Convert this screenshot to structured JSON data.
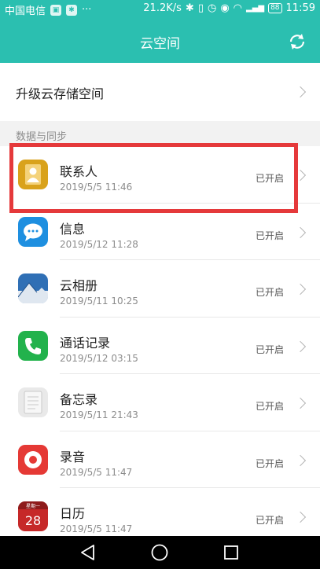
{
  "status_bar": {
    "carrier": "中国电信",
    "speed": "21.2K/s",
    "battery": "88",
    "time": "11:59"
  },
  "header": {
    "title": "云空间"
  },
  "upgrade": {
    "label": "升级云存储空间"
  },
  "section": {
    "title": "数据与同步"
  },
  "items": [
    {
      "name": "联系人",
      "time": "2019/5/5 11:46",
      "status": "已开启",
      "icon": "contacts-icon",
      "color": "#d9a21b"
    },
    {
      "name": "信息",
      "time": "2019/5/12 11:28",
      "status": "已开启",
      "icon": "message-icon",
      "color": "#1e8fe0"
    },
    {
      "name": "云相册",
      "time": "2019/5/11 10:25",
      "status": "已开启",
      "icon": "gallery-icon",
      "color": "#2f6fb5"
    },
    {
      "name": "通话记录",
      "time": "2019/5/12 03:15",
      "status": "已开启",
      "icon": "phone-icon",
      "color": "#22b24c"
    },
    {
      "name": "备忘录",
      "time": "2019/5/11 21:43",
      "status": "已开启",
      "icon": "notepad-icon",
      "color": "#e9e9e9"
    },
    {
      "name": "录音",
      "time": "2019/5/5 11:47",
      "status": "已开启",
      "icon": "recorder-icon",
      "color": "#e53935"
    },
    {
      "name": "日历",
      "time": "2019/5/5 11:47",
      "status": "已开启",
      "icon": "calendar-icon",
      "color": "#c62828",
      "calendar_day": "28",
      "calendar_weekday": "星期一"
    }
  ]
}
